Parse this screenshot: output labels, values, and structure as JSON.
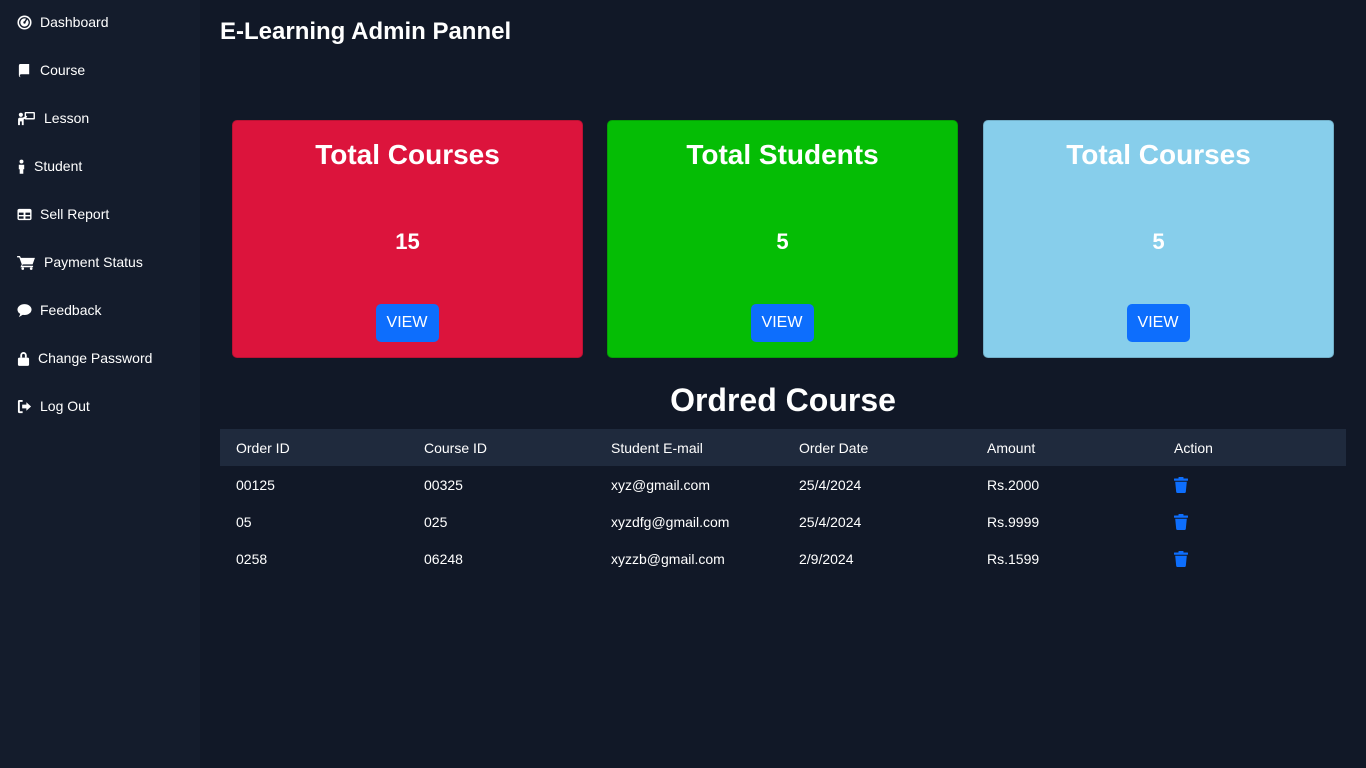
{
  "sidebar": {
    "items": [
      {
        "label": "Dashboard",
        "icon": "dashboard-gauge-icon"
      },
      {
        "label": "Course",
        "icon": "book-icon"
      },
      {
        "label": "Lesson",
        "icon": "teacher-board-icon"
      },
      {
        "label": "Student",
        "icon": "person-icon"
      },
      {
        "label": "Sell Report",
        "icon": "table-icon"
      },
      {
        "label": "Payment Status",
        "icon": "cart-icon"
      },
      {
        "label": "Feedback",
        "icon": "comment-icon"
      },
      {
        "label": "Change Password",
        "icon": "lock-icon"
      },
      {
        "label": "Log Out",
        "icon": "logout-icon"
      }
    ]
  },
  "header": {
    "title": "E-Learning Admin Pannel"
  },
  "cards": [
    {
      "title": "Total Courses",
      "value": "15",
      "button_label": "VIEW",
      "color": "#dc143c"
    },
    {
      "title": "Total Students",
      "value": "5",
      "button_label": "VIEW",
      "color": "#05bd05"
    },
    {
      "title": "Total Courses",
      "value": "5",
      "button_label": "VIEW",
      "color": "#87ceeb"
    }
  ],
  "orders": {
    "title": "Ordred Course",
    "columns": [
      "Order ID",
      "Course ID",
      "Student E-mail",
      "Order Date",
      "Amount",
      "Action"
    ],
    "rows": [
      {
        "order_id": "00125",
        "course_id": "00325",
        "email": "xyz@gmail.com",
        "date": "25/4/2024",
        "amount": "Rs.2000",
        "action_icon": "trash-icon"
      },
      {
        "order_id": "05",
        "course_id": "025",
        "email": "xyzdfg@gmail.com",
        "date": "25/4/2024",
        "amount": "Rs.9999",
        "action_icon": "trash-icon"
      },
      {
        "order_id": "0258",
        "course_id": "06248",
        "email": "xyzzb@gmail.com",
        "date": "2/9/2024",
        "amount": "Rs.1599",
        "action_icon": "trash-icon"
      }
    ]
  },
  "colors": {
    "background": "#111827",
    "sidebar": "#141c2c",
    "table_header": "#1f2a3d",
    "primary_button": "#0d6efd"
  }
}
